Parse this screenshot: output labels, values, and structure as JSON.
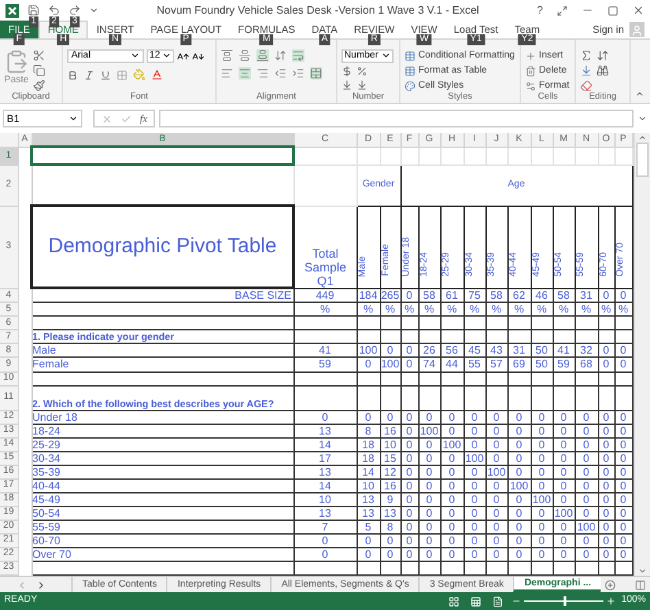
{
  "window": {
    "title": "Novum Foundry Vehicle Sales Desk -Version 1 Wave 3 V.1 - Excel",
    "help": "?"
  },
  "quick_access_key_tips": [
    "1",
    "2",
    "3"
  ],
  "ribbon_tabs": [
    {
      "label": "FILE",
      "kind": "file",
      "key_tip": "F",
      "selected": false
    },
    {
      "label": "HOME",
      "kind": "tab",
      "key_tip": "H",
      "selected": true
    },
    {
      "label": "INSERT",
      "kind": "tab",
      "key_tip": "N",
      "selected": false
    },
    {
      "label": "PAGE LAYOUT",
      "kind": "tab",
      "key_tip": "P",
      "selected": false
    },
    {
      "label": "FORMULAS",
      "kind": "tab",
      "key_tip": "M",
      "selected": false
    },
    {
      "label": "DATA",
      "kind": "tab",
      "key_tip": "A",
      "selected": false
    },
    {
      "label": "REVIEW",
      "kind": "tab",
      "key_tip": "R",
      "selected": false
    },
    {
      "label": "VIEW",
      "kind": "tab",
      "key_tip": "W",
      "selected": false
    },
    {
      "label": "Load Test",
      "kind": "tab",
      "key_tip": "Y1",
      "selected": false
    },
    {
      "label": "Team",
      "kind": "tab",
      "key_tip": "Y2",
      "selected": false
    }
  ],
  "sign_in": "Sign in",
  "ribbon": {
    "paste": "Paste",
    "font": "Arial",
    "font_size": "12",
    "number_format": "Number",
    "styles": [
      "Conditional Formatting",
      "Format as Table",
      "Cell Styles"
    ],
    "cells": [
      "Insert",
      "Delete",
      "Format"
    ],
    "groups": [
      "Clipboard",
      "Font",
      "Alignment",
      "Number",
      "Styles",
      "Cells",
      "Editing"
    ]
  },
  "formula_bar": {
    "name_box": "B1",
    "function_label": "fx"
  },
  "column_headers": [
    {
      "label": "A",
      "selected": false
    },
    {
      "label": "B",
      "selected": true
    },
    {
      "label": "C",
      "selected": false
    },
    {
      "label": "D",
      "selected": false
    },
    {
      "label": "E",
      "selected": false
    },
    {
      "label": "F",
      "selected": false
    },
    {
      "label": "G",
      "selected": false
    },
    {
      "label": "H",
      "selected": false
    },
    {
      "label": "I",
      "selected": false
    },
    {
      "label": "J",
      "selected": false
    },
    {
      "label": "K",
      "selected": false
    },
    {
      "label": "L",
      "selected": false
    },
    {
      "label": "M",
      "selected": false
    },
    {
      "label": "N",
      "selected": false
    },
    {
      "label": "O",
      "selected": false
    },
    {
      "label": "P",
      "selected": false
    }
  ],
  "row_numbers": [
    {
      "label": "1",
      "selected": true
    },
    {
      "label": "2",
      "selected": false
    },
    {
      "label": "3",
      "selected": false
    },
    {
      "label": "4",
      "selected": false
    },
    {
      "label": "5",
      "selected": false
    },
    {
      "label": "6",
      "selected": false
    },
    {
      "label": "7",
      "selected": false
    },
    {
      "label": "8",
      "selected": false
    },
    {
      "label": "9",
      "selected": false
    },
    {
      "label": "10",
      "selected": false
    },
    {
      "label": "11",
      "selected": false
    },
    {
      "label": "12",
      "selected": false
    },
    {
      "label": "13",
      "selected": false
    },
    {
      "label": "14",
      "selected": false
    },
    {
      "label": "15",
      "selected": false
    },
    {
      "label": "16",
      "selected": false
    },
    {
      "label": "17",
      "selected": false
    },
    {
      "label": "18",
      "selected": false
    },
    {
      "label": "19",
      "selected": false
    },
    {
      "label": "20",
      "selected": false
    },
    {
      "label": "21",
      "selected": false
    },
    {
      "label": "22",
      "selected": false
    },
    {
      "label": "23",
      "selected": false
    }
  ],
  "pivot": {
    "title": "Demographic Pivot Table",
    "total_header": "Total Sample Q1",
    "groups": [
      "Gender",
      "Age"
    ],
    "segments": [
      "Male",
      "Female",
      "Under 18",
      "18-24",
      "25-29",
      "30-34",
      "35-39",
      "40-44",
      "45-49",
      "50-54",
      "55-59",
      "60-70",
      "Over 70"
    ],
    "base_label": "BASE SIZE",
    "base": [
      "449",
      "184",
      "265",
      "0",
      "58",
      "61",
      "75",
      "58",
      "62",
      "46",
      "58",
      "31",
      "0",
      "0"
    ],
    "percent_row": [
      "%",
      "%",
      "%",
      "%",
      "%",
      "%",
      "%",
      "%",
      "%",
      "%",
      "%",
      "%",
      "%",
      "%"
    ],
    "questions": [
      {
        "title": "1. Please indicate your gender",
        "rows": [
          {
            "label": "Male",
            "values": [
              "41",
              "100",
              "0",
              "0",
              "26",
              "56",
              "45",
              "43",
              "31",
              "50",
              "41",
              "32",
              "0",
              "0"
            ]
          },
          {
            "label": "Female",
            "values": [
              "59",
              "0",
              "100",
              "0",
              "74",
              "44",
              "55",
              "57",
              "69",
              "50",
              "59",
              "68",
              "0",
              "0"
            ]
          }
        ]
      },
      {
        "title": "2. Which of the following best describes your AGE?",
        "rows": [
          {
            "label": "Under 18",
            "values": [
              "0",
              "0",
              "0",
              "0",
              "0",
              "0",
              "0",
              "0",
              "0",
              "0",
              "0",
              "0",
              "0",
              "0"
            ]
          },
          {
            "label": "18-24",
            "values": [
              "13",
              "8",
              "16",
              "0",
              "100",
              "0",
              "0",
              "0",
              "0",
              "0",
              "0",
              "0",
              "0",
              "0"
            ]
          },
          {
            "label": "25-29",
            "values": [
              "14",
              "18",
              "10",
              "0",
              "0",
              "100",
              "0",
              "0",
              "0",
              "0",
              "0",
              "0",
              "0",
              "0"
            ]
          },
          {
            "label": "30-34",
            "values": [
              "17",
              "18",
              "15",
              "0",
              "0",
              "0",
              "100",
              "0",
              "0",
              "0",
              "0",
              "0",
              "0",
              "0"
            ]
          },
          {
            "label": "35-39",
            "values": [
              "13",
              "14",
              "12",
              "0",
              "0",
              "0",
              "0",
              "100",
              "0",
              "0",
              "0",
              "0",
              "0",
              "0"
            ]
          },
          {
            "label": "40-44",
            "values": [
              "14",
              "10",
              "16",
              "0",
              "0",
              "0",
              "0",
              "0",
              "100",
              "0",
              "0",
              "0",
              "0",
              "0"
            ]
          },
          {
            "label": "45-49",
            "values": [
              "10",
              "13",
              "9",
              "0",
              "0",
              "0",
              "0",
              "0",
              "0",
              "100",
              "0",
              "0",
              "0",
              "0"
            ]
          },
          {
            "label": "50-54",
            "values": [
              "13",
              "13",
              "13",
              "0",
              "0",
              "0",
              "0",
              "0",
              "0",
              "0",
              "100",
              "0",
              "0",
              "0"
            ]
          },
          {
            "label": "55-59",
            "values": [
              "7",
              "5",
              "8",
              "0",
              "0",
              "0",
              "0",
              "0",
              "0",
              "0",
              "0",
              "100",
              "0",
              "0"
            ]
          },
          {
            "label": "60-70",
            "values": [
              "0",
              "0",
              "0",
              "0",
              "0",
              "0",
              "0",
              "0",
              "0",
              "0",
              "0",
              "0",
              "0",
              "0"
            ]
          },
          {
            "label": "Over 70",
            "values": [
              "0",
              "0",
              "0",
              "0",
              "0",
              "0",
              "0",
              "0",
              "0",
              "0",
              "0",
              "0",
              "0",
              "0"
            ]
          }
        ]
      }
    ]
  },
  "sheet_tabs": [
    {
      "label": "Table of Contents",
      "selected": false
    },
    {
      "label": "Interpreting Results",
      "selected": false
    },
    {
      "label": "All Elements, Segments & Q's",
      "selected": false
    },
    {
      "label": "3 Segment Break",
      "selected": false
    },
    {
      "label": "Demographi ...",
      "selected": true
    }
  ],
  "status_bar": {
    "status": "READY",
    "zoom": {
      "level": 0.5,
      "reading": "100%"
    }
  }
}
